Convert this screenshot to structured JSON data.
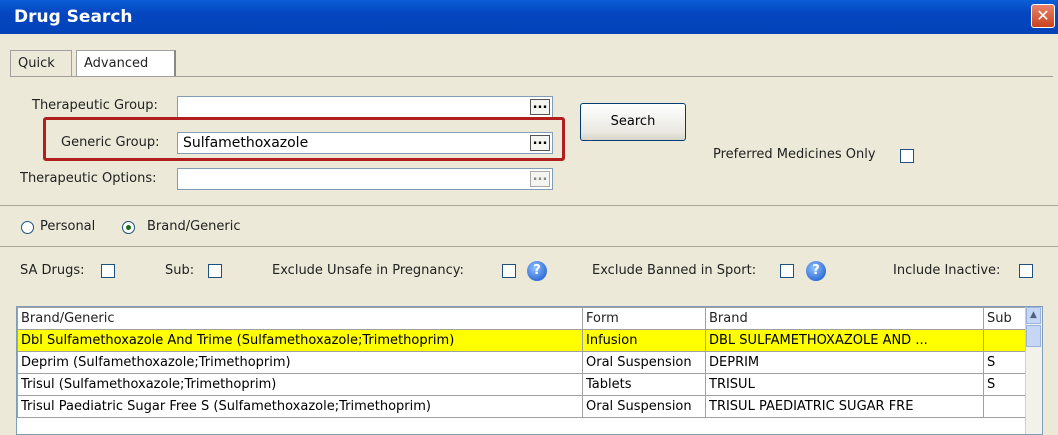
{
  "window": {
    "title": "Drug Search",
    "close_glyph": "✕"
  },
  "tabs": [
    {
      "label": "Quick"
    },
    {
      "label": "Advanced"
    }
  ],
  "form": {
    "therapeutic_group_label": "Therapeutic Group:",
    "therapeutic_group_value": "",
    "generic_group_label": "Generic Group:",
    "generic_group_value": "Sulfamethoxazole",
    "therapeutic_options_label": "Therapeutic Options:",
    "therapeutic_options_value": "",
    "ellipsis": "...",
    "search_button": "Search",
    "preferred_label": "Preferred Medicines Only"
  },
  "radios": {
    "personal": "Personal",
    "brand_generic": "Brand/Generic",
    "selected": "brand_generic"
  },
  "filters": {
    "sa_drugs": "SA Drugs:",
    "sub": "Sub:",
    "exclude_pregnancy": "Exclude Unsafe in Pregnancy:",
    "exclude_sport": "Exclude Banned in Sport:",
    "include_inactive": "Include Inactive:",
    "help_glyph": "?"
  },
  "grid": {
    "columns": [
      "Brand/Generic",
      "Form",
      "Brand",
      "Sub"
    ],
    "rows": [
      {
        "name": "Dbl Sulfamethoxazole And Trime (Sulfamethoxazole;Trimethoprim)",
        "form": "Infusion",
        "brand": "DBL SULFAMETHOXAZOLE AND ...",
        "sub": ""
      },
      {
        "name": "Deprim (Sulfamethoxazole;Trimethoprim)",
        "form": "Oral Suspension",
        "brand": "DEPRIM",
        "sub": "S"
      },
      {
        "name": "Trisul (Sulfamethoxazole;Trimethoprim)",
        "form": "Tablets",
        "brand": "TRISUL",
        "sub": "S"
      },
      {
        "name": "Trisul Paediatric Sugar Free S (Sulfamethoxazole;Trimethoprim)",
        "form": "Oral Suspension",
        "brand": "TRISUL PAEDIATRIC SUGAR FRE",
        "sub": ""
      }
    ]
  },
  "colors": {
    "title_bar": "#0545c0",
    "selected_row": "#ffff00",
    "highlight_box": "#b11e1e"
  }
}
